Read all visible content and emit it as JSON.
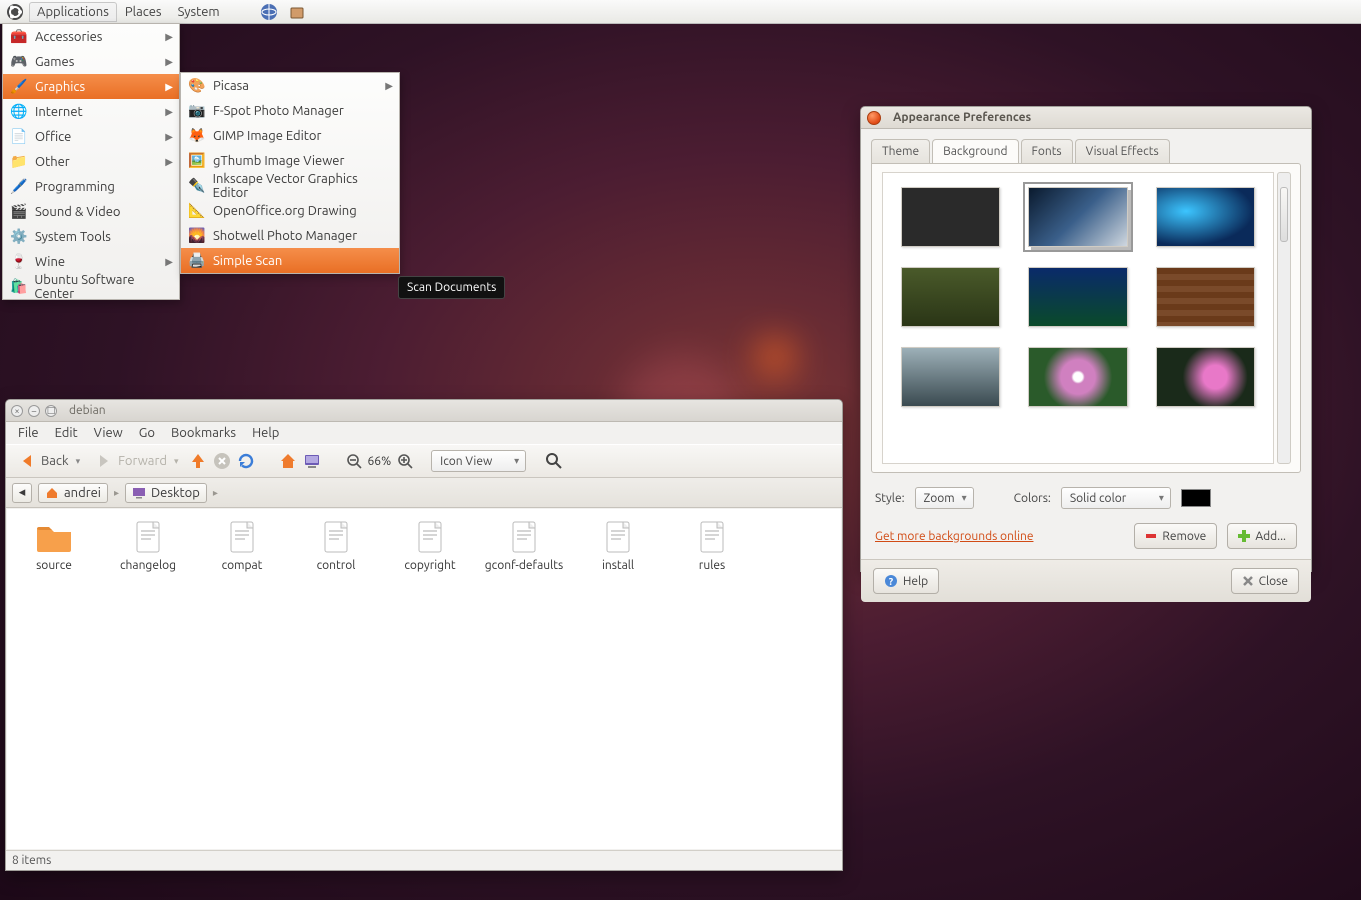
{
  "panel": {
    "menus": [
      "Applications",
      "Places",
      "System"
    ],
    "active": 0
  },
  "app_menu": {
    "items": [
      {
        "label": "Accessories",
        "icon": "🧰",
        "sub": true
      },
      {
        "label": "Games",
        "icon": "🎮",
        "sub": true
      },
      {
        "label": "Graphics",
        "icon": "🖌️",
        "sub": true,
        "hl": true
      },
      {
        "label": "Internet",
        "icon": "🌐",
        "sub": true
      },
      {
        "label": "Office",
        "icon": "📄",
        "sub": true
      },
      {
        "label": "Other",
        "icon": "📁",
        "sub": true
      },
      {
        "label": "Programming",
        "icon": "🖊️",
        "sub": false
      },
      {
        "label": "Sound & Video",
        "icon": "🎬",
        "sub": false
      },
      {
        "label": "System Tools",
        "icon": "⚙️",
        "sub": false
      },
      {
        "label": "Wine",
        "icon": "🍷",
        "sub": true
      },
      {
        "label": "Ubuntu Software Center",
        "icon": "🛍️",
        "sub": false
      }
    ]
  },
  "graphics_menu": {
    "items": [
      {
        "label": "Picasa",
        "icon": "🎨",
        "sub": true
      },
      {
        "label": "F-Spot Photo Manager",
        "icon": "📷"
      },
      {
        "label": "GIMP Image Editor",
        "icon": "🦊"
      },
      {
        "label": "gThumb Image Viewer",
        "icon": "🖼️"
      },
      {
        "label": "Inkscape Vector Graphics Editor",
        "icon": "✒️"
      },
      {
        "label": "OpenOffice.org Drawing",
        "icon": "📐"
      },
      {
        "label": "Shotwell Photo Manager",
        "icon": "🌄"
      },
      {
        "label": "Simple Scan",
        "icon": "🖨️",
        "hl": true
      }
    ]
  },
  "tooltip": "Scan Documents",
  "file_manager": {
    "title": "debian",
    "menus": [
      "File",
      "Edit",
      "View",
      "Go",
      "Bookmarks",
      "Help"
    ],
    "back": "Back",
    "forward": "Forward",
    "zoom": "66%",
    "view_mode": "Icon View",
    "breadcrumb": [
      {
        "label": "andrei",
        "icon": "home"
      },
      {
        "label": "Desktop",
        "icon": "desktop"
      }
    ],
    "items": [
      {
        "name": "source",
        "type": "folder"
      },
      {
        "name": "changelog",
        "type": "file"
      },
      {
        "name": "compat",
        "type": "file"
      },
      {
        "name": "control",
        "type": "file"
      },
      {
        "name": "copyright",
        "type": "file"
      },
      {
        "name": "gconf-defaults",
        "type": "file"
      },
      {
        "name": "install",
        "type": "file"
      },
      {
        "name": "rules",
        "type": "file"
      }
    ],
    "status": "8 items"
  },
  "appearance": {
    "title": "Appearance Preferences",
    "tabs": [
      "Theme",
      "Background",
      "Fonts",
      "Visual Effects"
    ],
    "active_tab": 1,
    "style_label": "Style:",
    "style_value": "Zoom",
    "colors_label": "Colors:",
    "colors_value": "Solid color",
    "link": "Get more backgrounds online",
    "remove": "Remove",
    "add": "Add...",
    "help": "Help",
    "close": "Close"
  }
}
